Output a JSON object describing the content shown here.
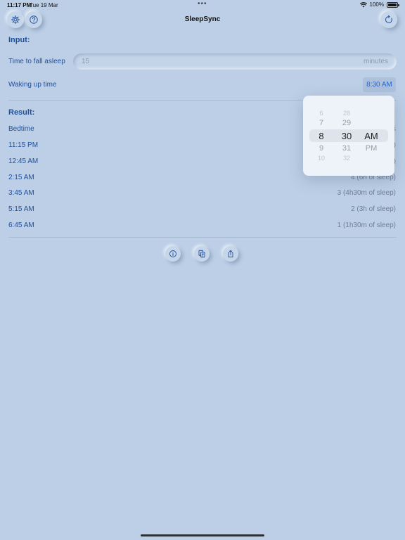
{
  "status": {
    "time": "11:17 PM",
    "date": "Tue 19 Mar",
    "battery": "100%"
  },
  "nav": {
    "title": "SleepSync"
  },
  "input": {
    "heading": "Input:",
    "fall_asleep_label": "Time to fall asleep",
    "fall_asleep_value": "15",
    "fall_asleep_unit": "minutes",
    "wake_label": "Waking up time",
    "wake_value": "8:30 AM"
  },
  "picker": {
    "hours": [
      "6",
      "7",
      "8",
      "9",
      "10"
    ],
    "minutes": [
      "28",
      "29",
      "30",
      "31",
      "32"
    ],
    "periods": [
      "AM",
      "PM"
    ],
    "selected_hour": "8",
    "selected_minute": "30",
    "selected_period": "AM"
  },
  "result": {
    "heading": "Result:",
    "bedtime_label": "Bedtime",
    "rows": [
      {
        "time": "11:15 PM",
        "detail": ")"
      },
      {
        "time": "12:45 AM",
        "detail": ")"
      },
      {
        "time": "2:15 AM",
        "detail": "4 (6h of sleep)"
      },
      {
        "time": "3:45 AM",
        "detail": "3 (4h30m of sleep)"
      },
      {
        "time": "5:15 AM",
        "detail": "2 (3h of sleep)"
      },
      {
        "time": "6:45 AM",
        "detail": "1 (1h30m of sleep)"
      }
    ]
  },
  "icons": {
    "settings": "gear-icon",
    "help": "question-icon",
    "reset": "refresh-icon",
    "info": "info-icon",
    "copy": "copy-icon",
    "share": "share-icon"
  },
  "colors": {
    "background": "#bccfe6",
    "accent": "#1f4f9a",
    "highlight": "#2a66c8"
  }
}
